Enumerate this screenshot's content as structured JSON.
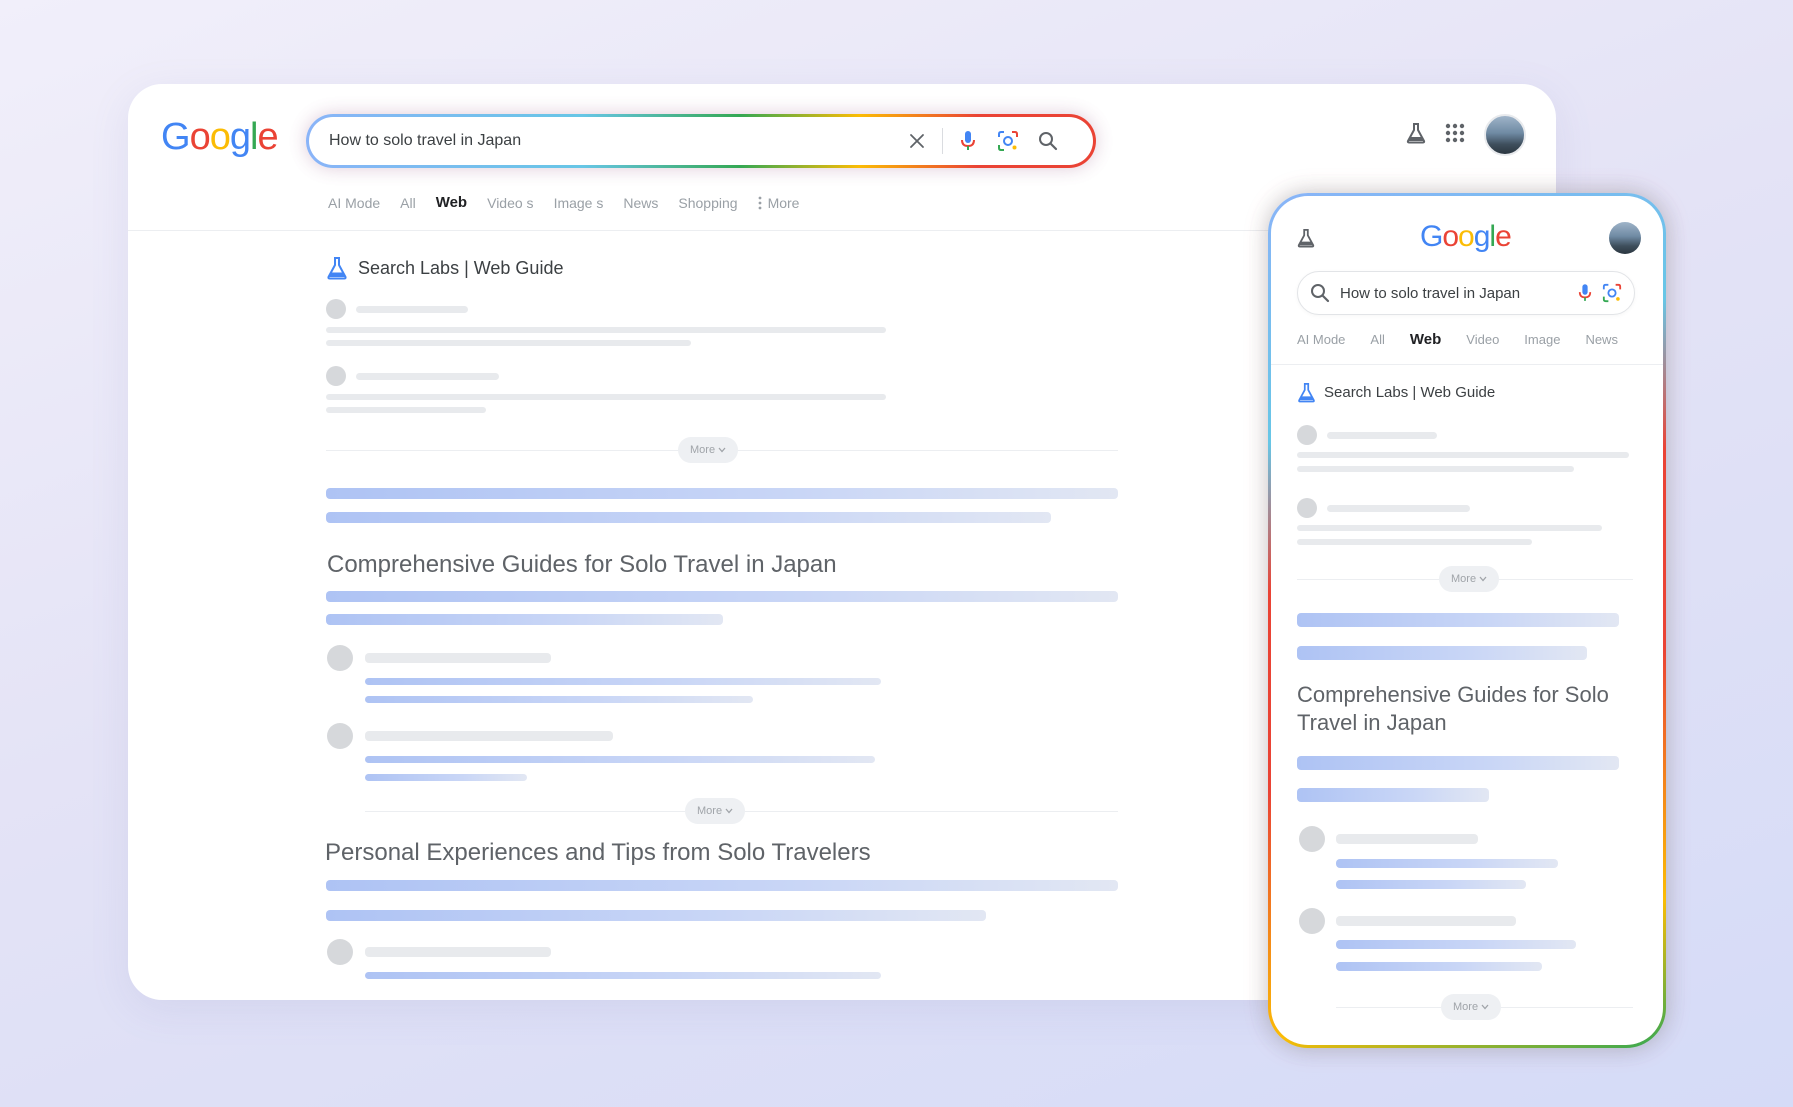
{
  "search": {
    "query": "How to solo travel in Japan"
  },
  "logo": {
    "letters": [
      "G",
      "o",
      "o",
      "g",
      "l",
      "e"
    ]
  },
  "desktop": {
    "tabs": [
      "AI Mode",
      "All",
      "Web",
      "Video s",
      "Image s",
      "News",
      "Shopping",
      "More"
    ],
    "active_tab": "Web",
    "labs_title": "Search Labs | Web Guide",
    "more_label": "More",
    "section_1": "Comprehensive Guides for Solo Travel in Japan",
    "section_2": "Personal Experiences and Tips from Solo Travelers"
  },
  "phone": {
    "tabs": [
      "AI Mode",
      "All",
      "Web",
      "Video",
      "Image",
      "News"
    ],
    "active_tab": "Web",
    "labs_title": "Search Labs | Web Guide",
    "more_label": "More",
    "section_1": "Comprehensive Guides for Solo Travel in Japan"
  },
  "colors": {
    "google_blue": "#4285f4",
    "google_red": "#ea4335",
    "google_yellow": "#fbbc05",
    "google_green": "#34a853"
  }
}
